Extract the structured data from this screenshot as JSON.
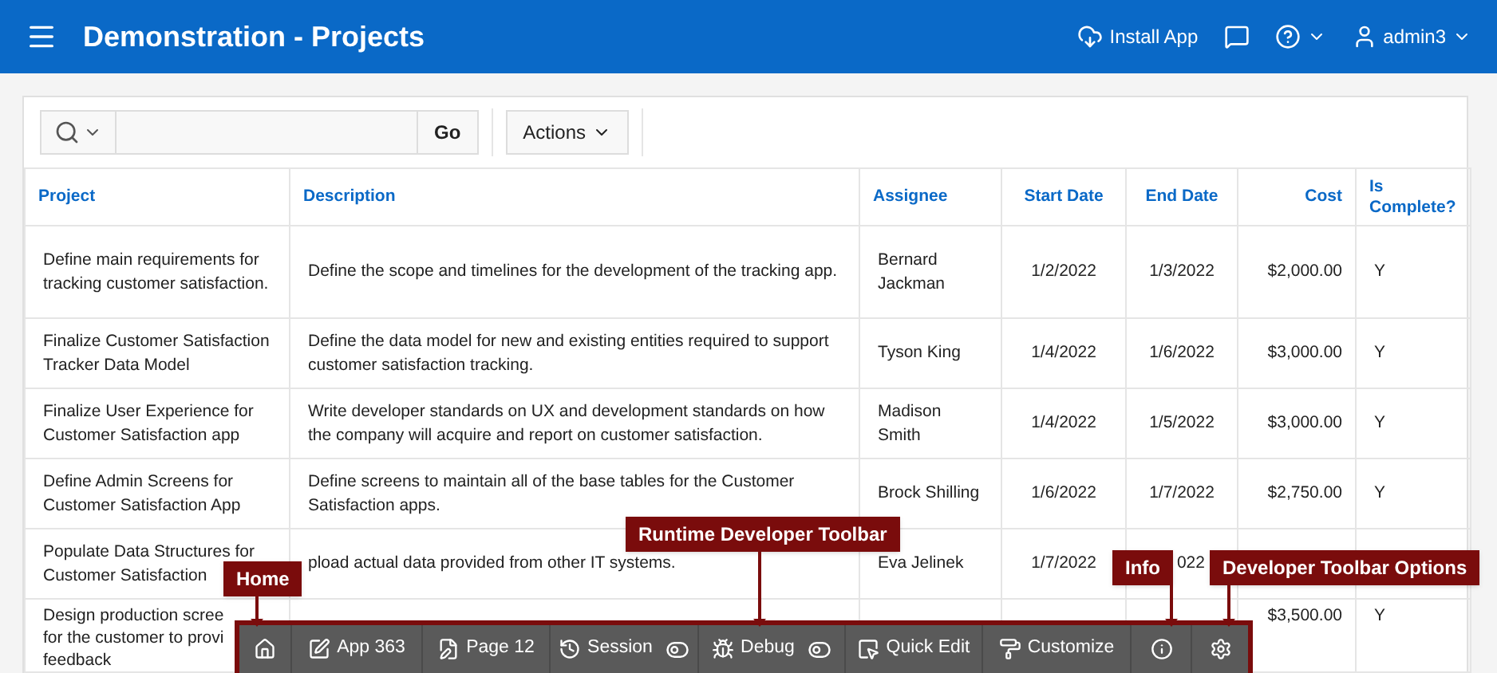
{
  "header": {
    "title": "Demonstration - Projects",
    "install": "Install App",
    "user": "admin3"
  },
  "report": {
    "go": "Go",
    "actions": "Actions",
    "columns": [
      "Project",
      "Description",
      "Assignee",
      "Start Date",
      "End Date",
      "Cost",
      "Is Complete?"
    ],
    "rows": [
      {
        "cells": [
          [
            "Define main requirements for tracking customer satisfaction."
          ],
          [
            "Define the scope and timelines for the development of the tracking app."
          ],
          [
            "Bernard Jackman"
          ],
          [
            "1/2/2022"
          ],
          [
            "1/3/2022"
          ],
          [
            "$2,000.00"
          ],
          [
            "Y"
          ]
        ]
      },
      {
        "cells": [
          [
            "Finalize Customer Satisfaction Tracker Data Model"
          ],
          [
            "Define the data model for new and existing entities required to support customer satisfaction tracking."
          ],
          [
            "Tyson King"
          ],
          [
            "1/4/2022"
          ],
          [
            "1/6/2022"
          ],
          [
            "$3,000.00"
          ],
          [
            "Y"
          ]
        ]
      },
      {
        "cells": [
          [
            "Finalize User Experience for Customer Satisfaction app"
          ],
          [
            "Write developer standards on UX and development standards on how the company will acquire and report on customer satisfaction."
          ],
          [
            "Madison Smith"
          ],
          [
            "1/4/2022"
          ],
          [
            "1/5/2022"
          ],
          [
            "$3,000.00"
          ],
          [
            "Y"
          ]
        ]
      },
      {
        "cells": [
          [
            "Define Admin Screens for Customer Satisfaction App"
          ],
          [
            "Define screens to maintain all of the base tables for the Customer Satisfaction apps."
          ],
          [
            "Brock Shilling"
          ],
          [
            "1/6/2022"
          ],
          [
            "1/7/2022"
          ],
          [
            "$2,750.00"
          ],
          [
            "Y"
          ]
        ]
      },
      {
        "cells": [
          [
            "Populate Data Structures for",
            "Customer Satisfaction"
          ],
          [
            "pload actual data provided from other IT systems."
          ],
          [
            "Eva Jelinek"
          ],
          [
            "1/7/2022"
          ],
          [
            "022"
          ],
          [],
          []
        ]
      },
      {
        "cells": [
          [
            "Design production scree",
            "for the customer to provi",
            "feedback"
          ],
          [],
          [],
          [],
          [],
          [
            "$3,500.00"
          ],
          [
            "Y"
          ]
        ]
      }
    ]
  },
  "dev_toolbar": [
    {
      "kind": "home"
    },
    {
      "kind": "app",
      "label": "App 363"
    },
    {
      "kind": "page",
      "label": "Page 12"
    },
    {
      "kind": "session",
      "label": "Session",
      "toggle": true
    },
    {
      "kind": "debug",
      "label": "Debug",
      "toggle": true
    },
    {
      "kind": "quickedit",
      "label": "Quick Edit"
    },
    {
      "kind": "customize",
      "label": "Customize"
    },
    {
      "kind": "info"
    },
    {
      "kind": "options"
    }
  ],
  "callouts": [
    {
      "label": "Home"
    },
    {
      "label": "Runtime Developer Toolbar"
    },
    {
      "label": "Info"
    },
    {
      "label": "Developer Toolbar Options"
    }
  ]
}
